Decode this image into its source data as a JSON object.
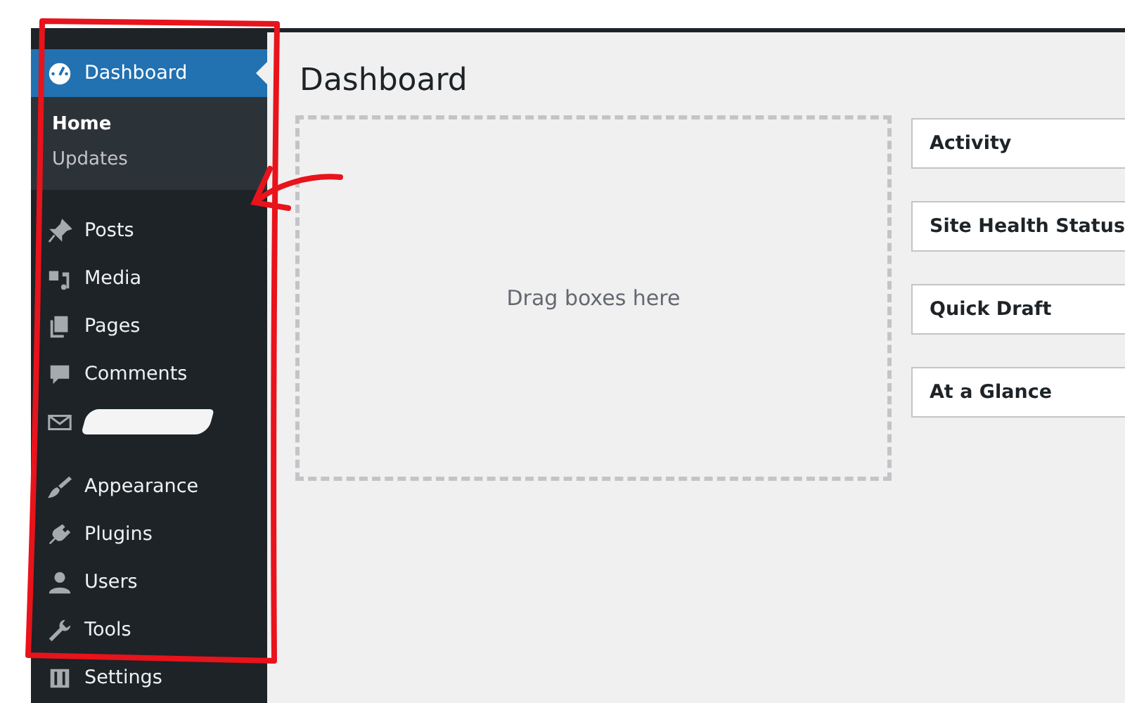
{
  "sidebar": {
    "items": [
      {
        "label": "Dashboard",
        "kind": "item",
        "selected": true,
        "children": [
          {
            "label": "Home",
            "selected": true
          },
          {
            "label": "Updates",
            "selected": false
          }
        ]
      },
      {
        "label": "Posts",
        "kind": "item",
        "selected": false
      },
      {
        "label": "Media",
        "kind": "item",
        "selected": false
      },
      {
        "label": "Pages",
        "kind": "item",
        "selected": false
      },
      {
        "label": "Comments",
        "kind": "item",
        "selected": false
      },
      {
        "kind": "redacted",
        "selected": false
      },
      {
        "label": "Appearance",
        "kind": "item",
        "selected": false,
        "separator": true
      },
      {
        "label": "Plugins",
        "kind": "item",
        "selected": false
      },
      {
        "label": "Users",
        "kind": "item",
        "selected": false
      },
      {
        "label": "Tools",
        "kind": "item",
        "selected": false
      },
      {
        "label": "Settings",
        "kind": "item",
        "selected": false
      }
    ]
  },
  "main": {
    "title": "Dashboard",
    "drop_zone": "Drag boxes here",
    "widgets": [
      "Activity",
      "Site Health Status",
      "Quick Draft",
      "At a Glance"
    ]
  }
}
